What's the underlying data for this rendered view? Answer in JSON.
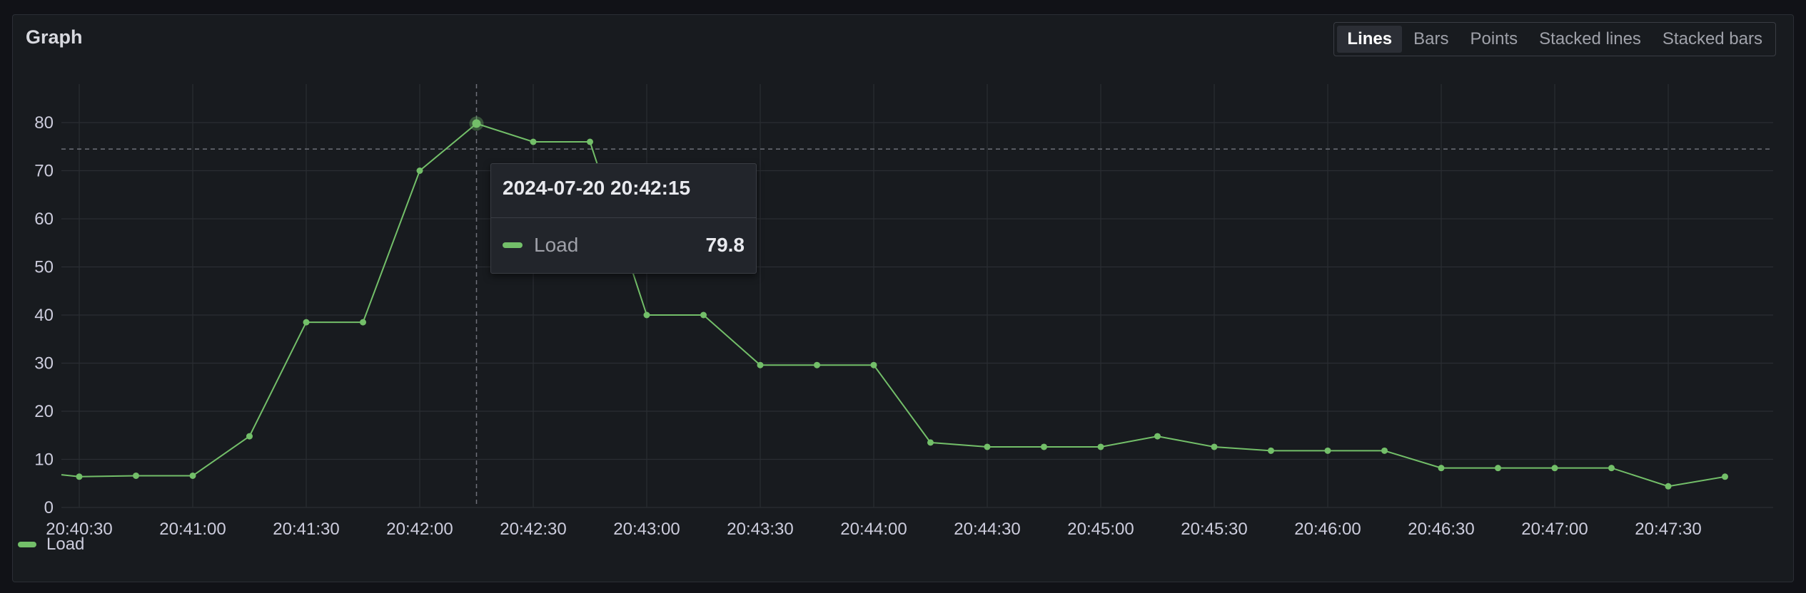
{
  "panel": {
    "title": "Graph"
  },
  "toolbar": {
    "options": [
      "Lines",
      "Bars",
      "Points",
      "Stacked lines",
      "Stacked bars"
    ],
    "selected": "Lines"
  },
  "colors": {
    "series": "#73bf69",
    "background": "#181b1f",
    "grid": "#2a2d33",
    "axis_text": "#ccccdc"
  },
  "tooltip": {
    "timestamp": "2024-07-20 20:42:15",
    "series_label": "Load",
    "value": "79.8"
  },
  "legend": {
    "label": "Load"
  },
  "chart_data": {
    "type": "line",
    "title": "Graph",
    "xlabel": "",
    "ylabel": "",
    "x_tick_labels": [
      "20:40:30",
      "20:41:00",
      "20:41:30",
      "20:42:00",
      "20:42:30",
      "20:43:00",
      "20:43:30",
      "20:44:00",
      "20:44:30",
      "20:45:00",
      "20:45:30",
      "20:46:00",
      "20:46:30",
      "20:47:00",
      "20:47:30"
    ],
    "y_ticks": [
      0,
      10,
      20,
      30,
      40,
      50,
      60,
      70,
      80
    ],
    "ylim": [
      0,
      88
    ],
    "grid": true,
    "legend_position": "bottom-left",
    "threshold_line": 74.5,
    "hover_time": "20:42:15",
    "series": [
      {
        "name": "Load",
        "x": [
          "20:40:25",
          "20:40:30",
          "20:40:45",
          "20:41:00",
          "20:41:15",
          "20:41:30",
          "20:41:45",
          "20:42:00",
          "20:42:15",
          "20:42:30",
          "20:42:45",
          "20:43:00",
          "20:43:15",
          "20:43:30",
          "20:43:45",
          "20:44:00",
          "20:44:15",
          "20:44:30",
          "20:44:45",
          "20:45:00",
          "20:45:15",
          "20:45:30",
          "20:45:45",
          "20:46:00",
          "20:46:15",
          "20:46:30",
          "20:46:45",
          "20:47:00",
          "20:47:15",
          "20:47:30",
          "20:47:45"
        ],
        "values": [
          6.8,
          6.4,
          6.6,
          6.6,
          14.8,
          38.5,
          38.5,
          70,
          79.8,
          76,
          76,
          40,
          40,
          29.6,
          29.6,
          29.6,
          13.5,
          12.6,
          12.6,
          12.6,
          14.8,
          12.6,
          11.8,
          11.8,
          11.8,
          8.2,
          8.2,
          8.2,
          8.2,
          4.4,
          6.4
        ]
      }
    ]
  }
}
